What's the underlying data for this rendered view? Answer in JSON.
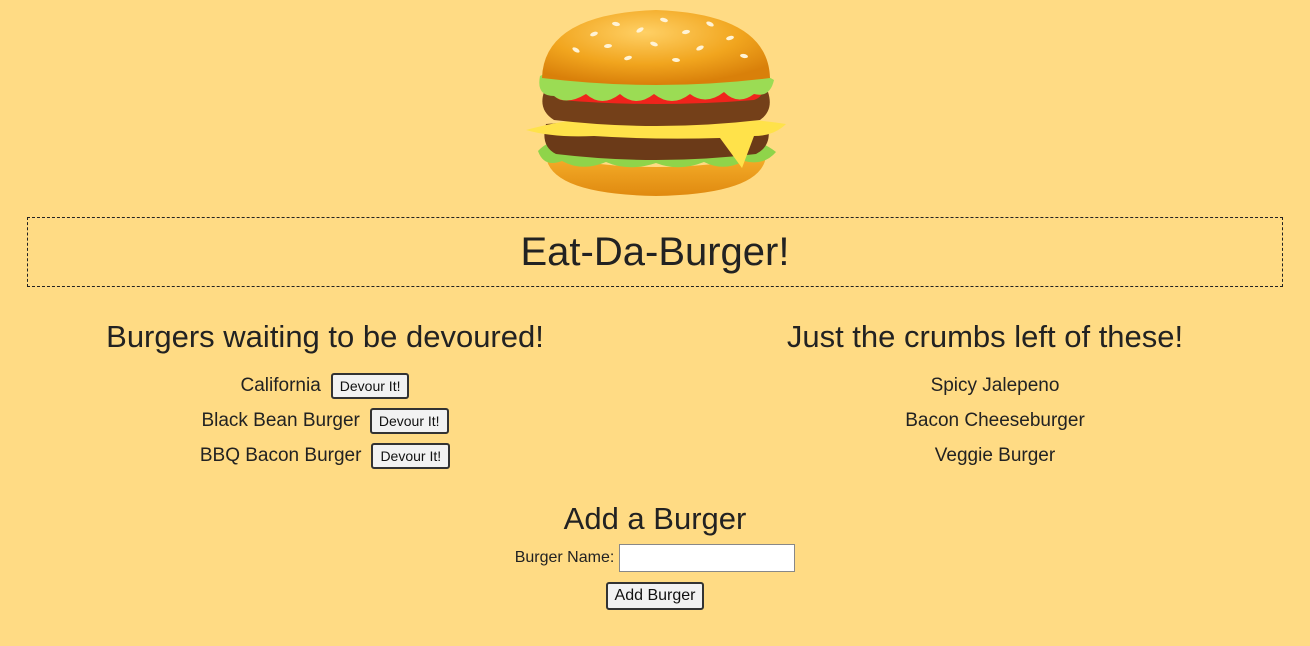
{
  "header": {
    "title": "Eat-Da-Burger!"
  },
  "waiting": {
    "heading": "Burgers waiting to be devoured!",
    "button_label": "Devour It!",
    "items": [
      "California",
      "Black Bean Burger",
      "BBQ Bacon Burger"
    ]
  },
  "devoured": {
    "heading": "Just the crumbs left of these!",
    "items": [
      "Spicy Jalepeno",
      "Bacon Cheeseburger",
      "Veggie Burger"
    ]
  },
  "add_form": {
    "heading": "Add a Burger",
    "name_label": "Burger Name:",
    "name_value": "",
    "submit_label": "Add Burger"
  },
  "colors": {
    "background": "#ffdb84"
  },
  "icons": {
    "logo": "burger-icon"
  }
}
